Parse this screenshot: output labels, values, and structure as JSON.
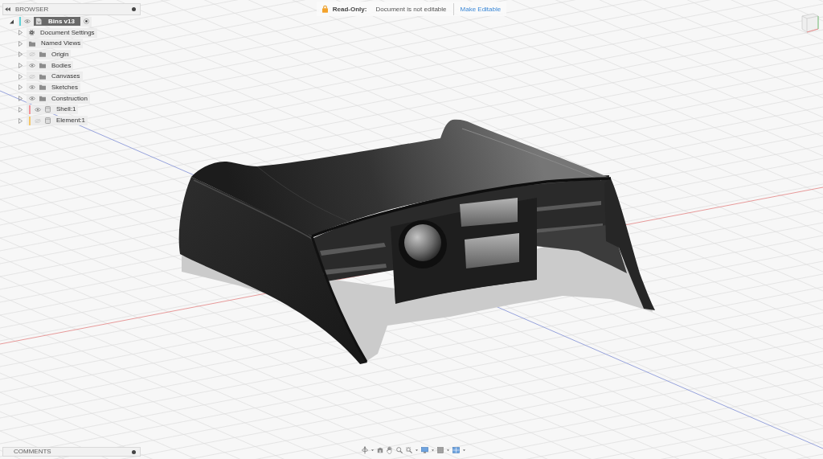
{
  "browser": {
    "title": "BROWSER",
    "tree": {
      "label": "Bins v13",
      "expanded": true,
      "visible": true,
      "active": true,
      "color": "#5fd0d6",
      "children": [
        {
          "label": "Document Settings",
          "kind": "settings",
          "expanded": false
        },
        {
          "label": "Named Views",
          "kind": "folder",
          "expanded": false
        },
        {
          "label": "Origin",
          "kind": "folder",
          "expanded": false,
          "visible": false
        },
        {
          "label": "Bodies",
          "kind": "folder",
          "expanded": false,
          "visible": true
        },
        {
          "label": "Canvases",
          "kind": "folder",
          "expanded": false,
          "visible": false
        },
        {
          "label": "Sketches",
          "kind": "folder",
          "expanded": false,
          "visible": true
        },
        {
          "label": "Construction",
          "kind": "folder",
          "expanded": false,
          "visible": true
        },
        {
          "label": "Shell:1",
          "kind": "component",
          "expanded": false,
          "visible": true,
          "color": "#f1959c"
        },
        {
          "label": "Element:1",
          "kind": "component",
          "expanded": false,
          "visible": false,
          "color": "#f5c76a"
        }
      ]
    }
  },
  "read_only": {
    "label": "Read-Only:",
    "message": "Document is not editable",
    "action": "Make Editable"
  },
  "comments": {
    "title": "COMMENTS"
  }
}
